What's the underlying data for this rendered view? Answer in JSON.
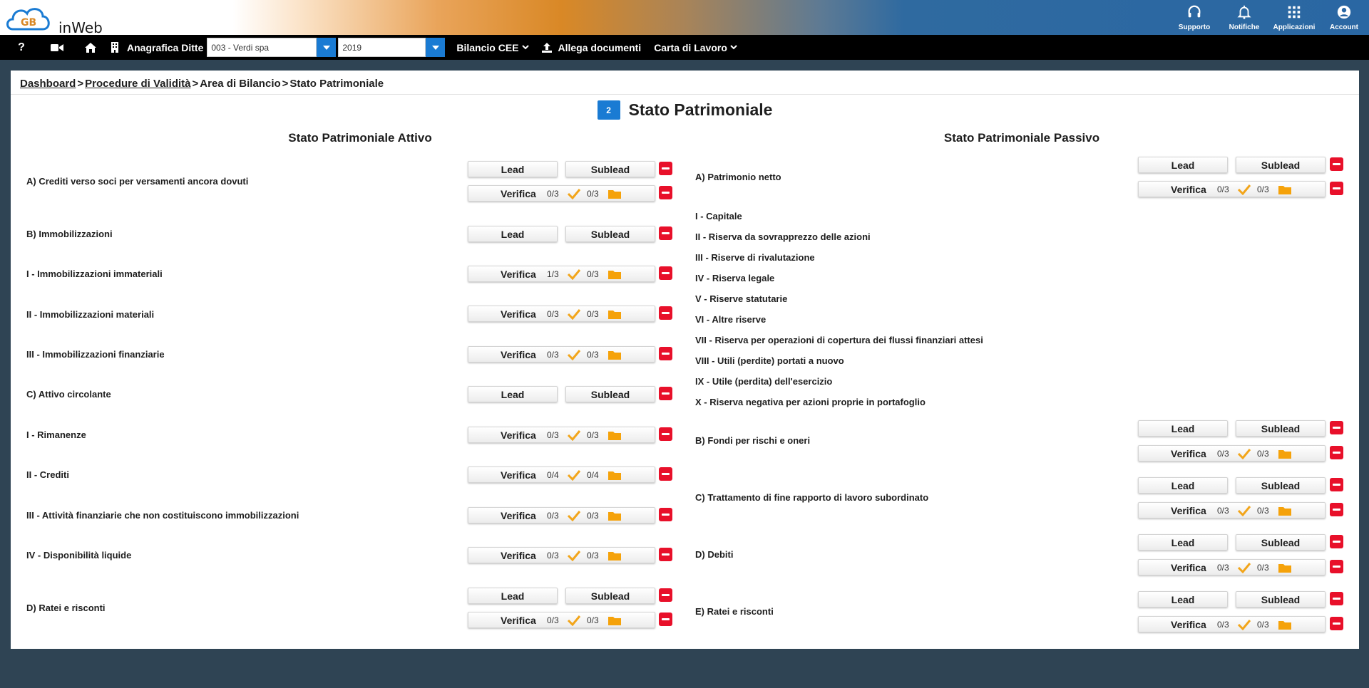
{
  "app": {
    "logo_text": "inWeb",
    "logo_initials": "GB"
  },
  "top_actions": [
    {
      "label": "Supporto",
      "icon": "headset-icon"
    },
    {
      "label": "Notifiche",
      "icon": "bell-icon"
    },
    {
      "label": "Applicazioni",
      "icon": "apps-grid-icon"
    },
    {
      "label": "Account",
      "icon": "account-circle-icon"
    }
  ],
  "navbar": {
    "help_glyph": "?",
    "anagrafica_label": "Anagrafica Ditte",
    "company_value": "003 - Verdi spa",
    "year_value": "2019",
    "bilancio_label": "Bilancio CEE",
    "allega_label": "Allega documenti",
    "carta_label": "Carta di Lavoro"
  },
  "breadcrumb": {
    "dashboard": "Dashboard",
    "procedure": "Procedure di Validità",
    "area": "Area di Bilancio",
    "current": "Stato Patrimoniale",
    "separator": ">"
  },
  "page": {
    "badge": "2",
    "title": "Stato Patrimoniale"
  },
  "buttons": {
    "lead": "Lead",
    "sublead": "Sublead",
    "verifica": "Verifica"
  },
  "attivo": {
    "title": "Stato Patrimoniale Attivo",
    "rows": [
      {
        "label": "A) Crediti verso soci per versamenti ancora dovuti",
        "v1": "0/3",
        "v2": "0/3"
      },
      {
        "label": "B) Immobilizzazioni"
      },
      {
        "label": "I - Immobilizzazioni immateriali",
        "v1": "1/3",
        "v2": "0/3"
      },
      {
        "label": "II - Immobilizzazioni materiali",
        "v1": "0/3",
        "v2": "0/3"
      },
      {
        "label": "III - Immobilizzazioni finanziarie",
        "v1": "0/3",
        "v2": "0/3"
      },
      {
        "label": "C) Attivo circolante"
      },
      {
        "label": "I - Rimanenze",
        "v1": "0/3",
        "v2": "0/3"
      },
      {
        "label": "II - Crediti",
        "v1": "0/4",
        "v2": "0/4"
      },
      {
        "label": "III - Attività finanziarie che non costituiscono immobilizzazioni",
        "v1": "0/3",
        "v2": "0/3"
      },
      {
        "label": "IV - Disponibilità liquide",
        "v1": "0/3",
        "v2": "0/3"
      },
      {
        "label": "D) Ratei e risconti",
        "v1": "0/3",
        "v2": "0/3"
      }
    ]
  },
  "passivo": {
    "title": "Stato Patrimoniale Passivo",
    "rows": [
      {
        "label": "A) Patrimonio netto",
        "v1": "0/3",
        "v2": "0/3"
      },
      {
        "label": "I - Capitale"
      },
      {
        "label": "II - Riserva da sovrapprezzo delle azioni"
      },
      {
        "label": "III - Riserve di rivalutazione"
      },
      {
        "label": "IV - Riserva legale"
      },
      {
        "label": "V - Riserve statutarie"
      },
      {
        "label": "VI - Altre riserve"
      },
      {
        "label": "VII - Riserva per operazioni di copertura dei flussi finanziari attesi"
      },
      {
        "label": "VIII - Utili (perdite) portati a nuovo"
      },
      {
        "label": "IX - Utile (perdita) dell'esercizio"
      },
      {
        "label": "X - Riserva negativa per azioni proprie in portafoglio"
      },
      {
        "label": "B) Fondi per rischi e oneri",
        "v1": "0/3",
        "v2": "0/3"
      },
      {
        "label": "C) Trattamento di fine rapporto di lavoro subordinato",
        "v1": "0/3",
        "v2": "0/3"
      },
      {
        "label": "D) Debiti",
        "v1": "0/3",
        "v2": "0/3"
      },
      {
        "label": "E) Ratei e risconti",
        "v1": "0/3",
        "v2": "0/3"
      }
    ]
  },
  "colors": {
    "accent_blue": "#1a7bd3",
    "danger_red": "#e8102a",
    "check_orange": "#f2a51a",
    "folder_orange": "#f5a20a",
    "page_bg": "#2f4454"
  }
}
